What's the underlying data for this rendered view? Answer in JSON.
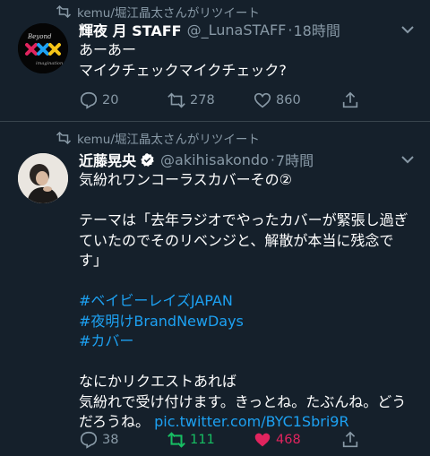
{
  "colors": {
    "background": "#15202b",
    "muted": "#8899a6",
    "link": "#1da1f2",
    "retweet_active": "#17bf63",
    "like_active": "#e0245e"
  },
  "tweets": [
    {
      "retweeted_by": "kemu/堀江晶太さんがリツイート",
      "display_name": "輝夜 月 STAFF",
      "handle": "@_LunaSTAFF",
      "separator": "·",
      "time": "18時間",
      "verified": false,
      "lines": [
        "あーあー",
        "マイクチェックマイクチェック?"
      ],
      "reply_count": "20",
      "retweet_count": "278",
      "like_count": "860",
      "icons": [
        "retweet-icon",
        "chevron-down-icon",
        "reply-icon",
        "retweet-icon",
        "heart-icon",
        "share-icon"
      ]
    },
    {
      "retweeted_by": "kemu/堀江晶太さんがリツイート",
      "display_name": "近藤晃央",
      "handle": "@akihisakondo",
      "separator": "·",
      "time": "7時間",
      "verified": true,
      "lines": [
        "気紛れワンコーラスカバーその②",
        "",
        "テーマは「去年ラジオでやったカバーが緊張し過ぎ",
        "ていたのでそのリベンジと、解散が本当に残念で",
        "す」",
        "",
        "#ベイビーレイズJAPAN",
        "#夜明けBrandNewDays",
        "#カバー",
        "",
        "なにかリクエストあれば",
        "気紛れで受け付けます。きっとね。たぶんね。どう",
        "だろうね。"
      ],
      "pic_link": "pic.twitter.com/BYC1Sbri9R",
      "reply_count": "38",
      "retweet_count": "111",
      "like_count": "468",
      "retweeted": true,
      "liked": true
    }
  ]
}
